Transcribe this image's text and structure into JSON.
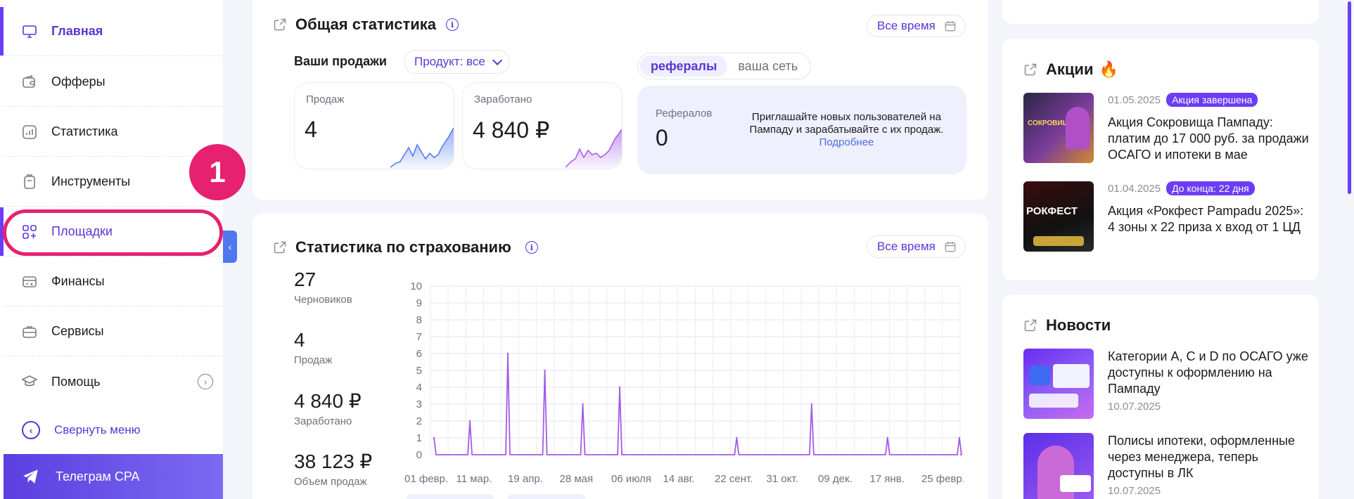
{
  "sidebar": {
    "items": [
      {
        "label": "Главная",
        "icon": "monitor-icon"
      },
      {
        "label": "Офферы",
        "icon": "wallet-icon"
      },
      {
        "label": "Статистика",
        "icon": "chart-icon"
      },
      {
        "label": "Инструменты",
        "icon": "tools-icon"
      },
      {
        "label": "Площадки",
        "icon": "grid-plus-icon"
      },
      {
        "label": "Финансы",
        "icon": "finance-icon"
      },
      {
        "label": "Сервисы",
        "icon": "briefcase-icon"
      },
      {
        "label": "Помощь",
        "icon": "graduation-cap-icon"
      }
    ],
    "collapse_label": "Свернуть меню",
    "telegram_label": "Телеграм CPA"
  },
  "annotation": {
    "number": "1",
    "color": "#e6216f"
  },
  "general_stats": {
    "title": "Общая статистика",
    "period": "Все время",
    "sales_label": "Ваши продажи",
    "product_filter": "Продукт: все",
    "sales_count_label": "Продаж",
    "sales_count_value": "4",
    "earned_label": "Заработано",
    "earned_value": "4 840 ₽",
    "tabs": [
      "рефералы",
      "ваша сеть"
    ],
    "referrals_label": "Рефералов",
    "referrals_value": "0",
    "invite_text": "Приглашайте новых пользователей на Пампаду и зарабатывайте с их продаж.",
    "invite_link": "Подробнее"
  },
  "insurance_stats": {
    "title": "Статистика по страхованию",
    "period": "Все время",
    "stats": [
      {
        "value": "27",
        "label": "Черновиков"
      },
      {
        "value": "4",
        "label": "Продаж"
      },
      {
        "value": "4 840 ₽",
        "label": "Заработано"
      },
      {
        "value": "38 123 ₽",
        "label": "Объем продаж"
      }
    ]
  },
  "chart_data": {
    "type": "line",
    "x_ticks": [
      "01 февр.",
      "11 мар.",
      "19 апр.",
      "28 мая",
      "06 июля",
      "14 авг.",
      "22 сент.",
      "31 окт.",
      "09 дек.",
      "17 янв.",
      "25 февр."
    ],
    "ylim": [
      0,
      10
    ],
    "y_ticks": [
      0,
      1,
      2,
      3,
      4,
      5,
      6,
      7,
      8,
      9,
      10
    ],
    "grid": true,
    "series_color": "#a45be8",
    "x_span_days": 420,
    "points": [
      {
        "day": 0,
        "y": 1
      },
      {
        "day": 35,
        "y": 2
      },
      {
        "day": 72,
        "y": 6
      },
      {
        "day": 108,
        "y": 5
      },
      {
        "day": 145,
        "y": 3
      },
      {
        "day": 181,
        "y": 4
      },
      {
        "day": 295,
        "y": 1
      },
      {
        "day": 368,
        "y": 3
      },
      {
        "day": 442,
        "y": 1
      },
      {
        "day": 512,
        "y": 1
      }
    ]
  },
  "promotions": {
    "title": "Акции",
    "items": [
      {
        "date": "01.05.2025",
        "tag": "Акция завершена",
        "title": "Акция Сокровища Пампаду: платим до 17 000 руб. за продажи ОСАГО и ипотеки в мае",
        "thumb_text": "СОКРОВИЩА"
      },
      {
        "date": "01.04.2025",
        "tag": "До конца: 22 дня",
        "title": "Акция «Рокфест Pampadu 2025»: 4 зоны х 22 приза х вход от 1 ЦД",
        "thumb_text": "РОКФЕСТ"
      }
    ]
  },
  "news": {
    "title": "Новости",
    "items": [
      {
        "title": "Категории A, C и D по ОСАГО уже доступны к оформлению на Пампаду",
        "date": "10.07.2025"
      },
      {
        "title": "Полисы ипотеки, оформленные через менеджера, теперь доступны в ЛК",
        "date": "10.07.2025"
      }
    ]
  }
}
